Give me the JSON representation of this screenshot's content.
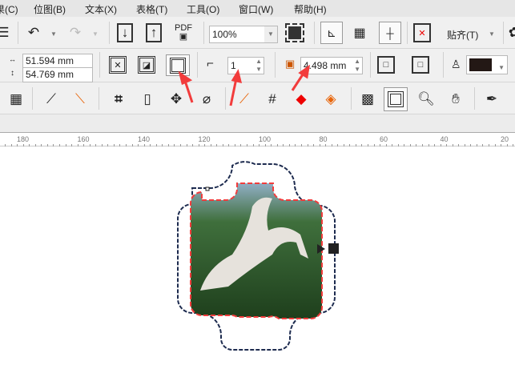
{
  "menu": [
    "果(C)",
    "位图(B)",
    "文本(X)",
    "表格(T)",
    "工具(O)",
    "窗口(W)",
    "帮助(H)"
  ],
  "toolbar": {
    "zoom_value": "100%",
    "pdf_label": "PDF",
    "snap_label": "贴齐(T)"
  },
  "property_bar": {
    "width": "51.594 mm",
    "height": "54.769 mm",
    "steps": "1",
    "offset": "4.498 mm",
    "outline_color": "#231815"
  },
  "ruler": {
    "ticks": [
      "180",
      "160",
      "140",
      "120",
      "100",
      "80",
      "60",
      "40",
      "20"
    ]
  },
  "colors": {
    "accent_red": "#f23c3c",
    "frame_outline": "#1d2b4f"
  }
}
